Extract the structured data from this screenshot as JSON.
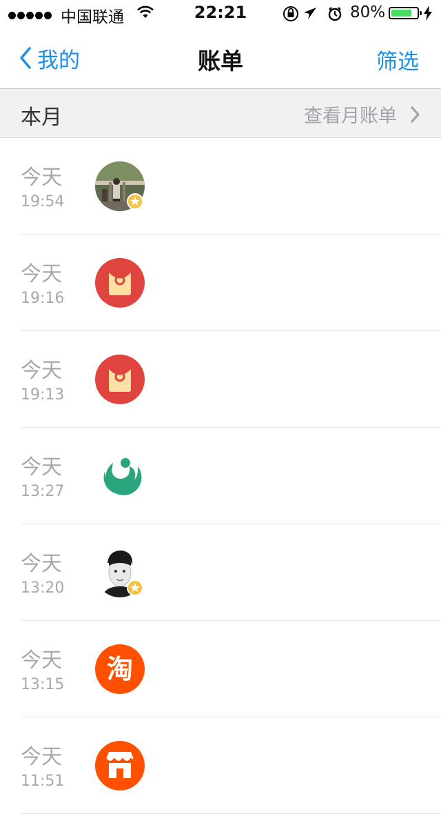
{
  "status_bar": {
    "carrier": "中国联通",
    "time": "22:21",
    "battery": "80%",
    "battery_level": 0.8
  },
  "nav": {
    "back_label": "我的",
    "title": "账单",
    "filter_label": "筛选"
  },
  "section": {
    "title": "本月",
    "link_label": "查看月账单"
  },
  "transactions": [
    {
      "day": "今天",
      "time": "19:54",
      "icon": "user-photo-avatar-icon"
    },
    {
      "day": "今天",
      "time": "19:16",
      "icon": "red-envelope-icon"
    },
    {
      "day": "今天",
      "time": "19:13",
      "icon": "red-envelope-icon"
    },
    {
      "day": "今天",
      "time": "13:27",
      "icon": "green-service-logo-icon"
    },
    {
      "day": "今天",
      "time": "13:20",
      "icon": "user-photo-avatar-icon"
    },
    {
      "day": "今天",
      "time": "13:15",
      "icon": "taobao-icon"
    },
    {
      "day": "今天",
      "time": "11:51",
      "icon": "shop-icon"
    }
  ],
  "colors": {
    "accent": "#1b8ee6",
    "red_envelope": "#e0443e",
    "taobao": "#ff5000",
    "green_logo": "#2aa57e"
  }
}
